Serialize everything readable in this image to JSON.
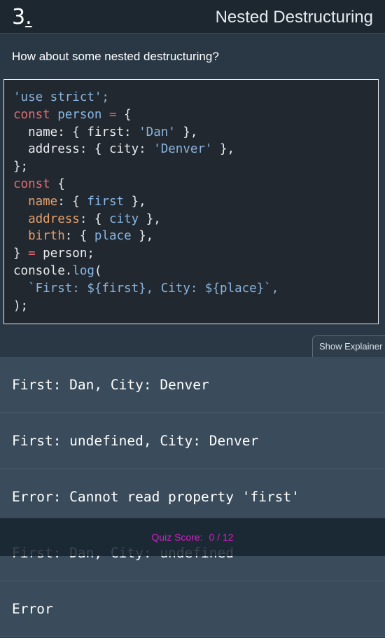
{
  "header": {
    "number": "3",
    "number_suffix": ".",
    "title": "Nested Destructuring"
  },
  "question": {
    "prompt": "How about some nested destructuring?"
  },
  "code": {
    "l1": "'use strict';",
    "l2_kw": "const",
    "l2_var": "person",
    "l2_op": "=",
    "l2_rest": "{",
    "l3_pre": "  name: { first: ",
    "l3_str": "'Dan'",
    "l3_post": " },",
    "l4_pre": "  address: { city: ",
    "l4_str": "'Denver'",
    "l4_post": " },",
    "l5": "};",
    "l6_kw": "const",
    "l6_rest": " {",
    "l7_prop": "name",
    "l7_mid": ": { ",
    "l7_var": "first",
    "l7_post": " },",
    "l8_prop": "address",
    "l8_mid": ": { ",
    "l8_var": "city",
    "l8_post": " },",
    "l9_prop": "birth",
    "l9_mid": ": { ",
    "l9_var": "place",
    "l9_post": " },",
    "l10_pre": "} ",
    "l10_op": "=",
    "l10_post": " person;",
    "l11_obj": "console",
    "l11_dot": ".",
    "l11_fn": "log",
    "l11_post": "(",
    "l12": "  `First: ${first}, City: ${place}`,",
    "l13": ");"
  },
  "explainer": {
    "label": "Show Explainer"
  },
  "answers": [
    "First: Dan, City: Denver",
    "First: undefined, City: Denver",
    "Error: Cannot read property 'first'",
    "First: Dan, City: undefined",
    "Error"
  ],
  "score": {
    "label": "Quiz Score:",
    "value": "0 / 12"
  },
  "colors": {
    "background": "#2a3846",
    "header": "#1d2730",
    "code_bg": "#22282f",
    "answer_bg": "#3a4c5b",
    "score_text": "#d21fc4",
    "keyword": "#e06c75",
    "string": "#8ab4dd",
    "property": "#e5a06b"
  }
}
